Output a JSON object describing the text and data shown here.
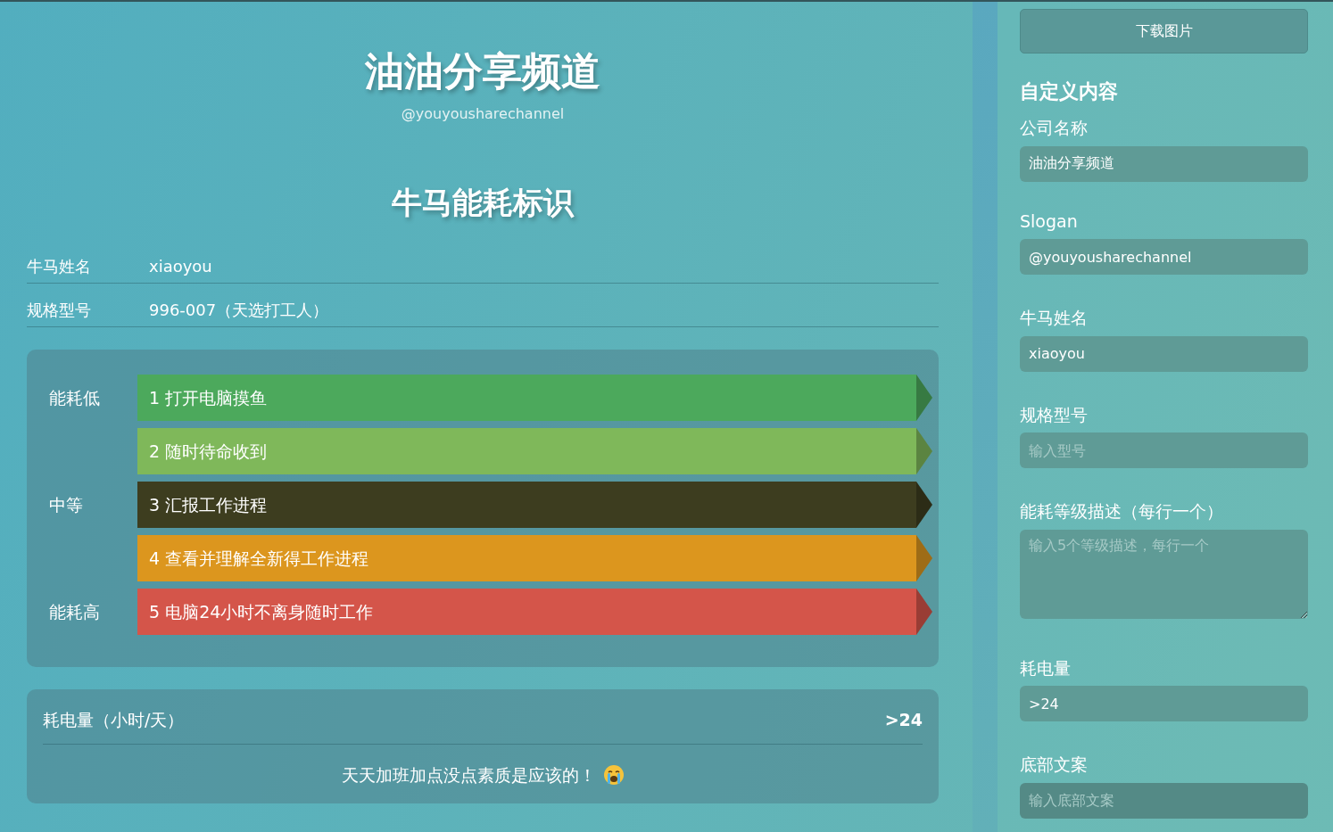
{
  "poster": {
    "company": "油油分享频道",
    "slogan": "@youyousharechannel",
    "title": "牛马能耗标识",
    "info_rows": [
      {
        "label": "牛马姓名",
        "value": "xiaoyou"
      },
      {
        "label": "规格型号",
        "value": "996-007（天选打工人）"
      }
    ],
    "levels": [
      {
        "side_label": "能耗低",
        "text": "1 打开电脑摸鱼",
        "color": "#4ca95c"
      },
      {
        "text": "2 随时待命收到",
        "color": "#7fb85a"
      },
      {
        "side_label": "中等",
        "text": "3 汇报工作进程",
        "color": "#3d3d1f"
      },
      {
        "text": "4 查看并理解全新得工作进程",
        "color": "#dc961e"
      },
      {
        "side_label": "能耗高",
        "text": "5 电脑24小时不离身随时工作",
        "color": "#d4554a"
      }
    ],
    "power": {
      "label": "耗电量（小时/天）",
      "value": ">24"
    },
    "footer": "天天加班加点没点素质是应该的！"
  },
  "sidebar": {
    "download_button": "下载图片",
    "heading": "自定义内容",
    "fields": [
      {
        "kind": "input",
        "label": "公司名称",
        "value": "油油分享频道"
      },
      {
        "kind": "input",
        "label": "Slogan",
        "value": "@youyousharechannel"
      },
      {
        "kind": "input",
        "label": "牛马姓名",
        "value": "xiaoyou"
      },
      {
        "kind": "input",
        "label": "规格型号",
        "placeholder": "输入型号"
      },
      {
        "kind": "textarea",
        "label": "能耗等级描述（每行一个）",
        "placeholder": "输入5个等级描述，每行一个"
      },
      {
        "kind": "input",
        "label": "耗电量",
        "value": ">24"
      },
      {
        "kind": "input",
        "label": "底部文案",
        "placeholder": "输入底部文案",
        "focused": true
      }
    ]
  }
}
